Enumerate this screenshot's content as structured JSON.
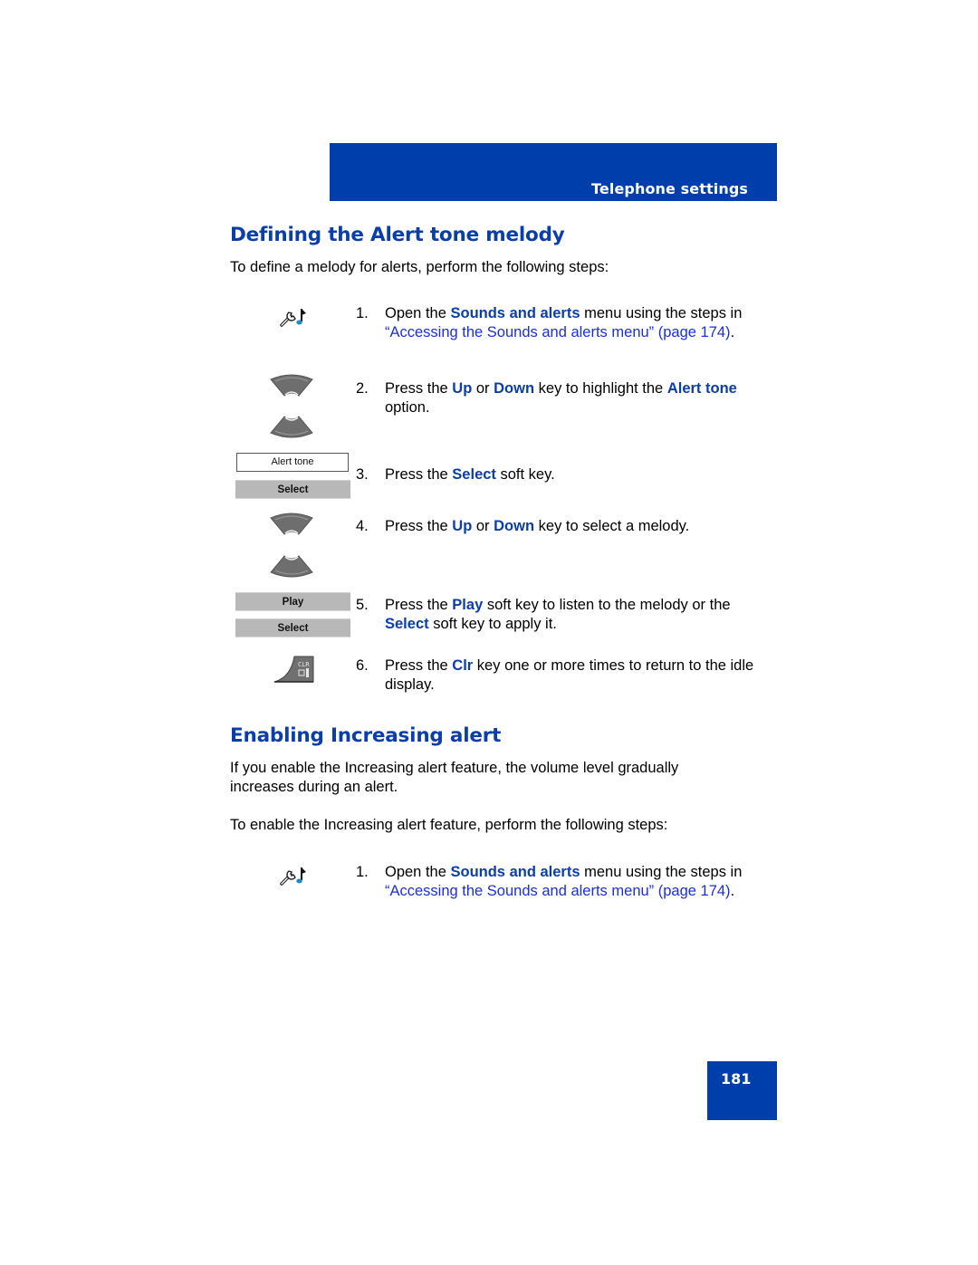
{
  "header": {
    "section_title": "Telephone settings",
    "band_color": "#003fab"
  },
  "section1": {
    "heading": "Defining the Alert tone melody",
    "intro": "To define a melody for alerts, perform the following steps:",
    "display_label": "Alert tone",
    "softkeys": {
      "select_a": "Select",
      "play": "Play",
      "select_b": "Select"
    },
    "clr_key_label": "CLR",
    "steps": [
      {
        "num": "1.",
        "parts": {
          "a": "Open the ",
          "b": "Sounds and alerts",
          "c": " menu using the steps in ",
          "link": "“Accessing the Sounds and alerts menu” (page 174)",
          "d": "."
        }
      },
      {
        "num": "2.",
        "parts": {
          "a": "Press the ",
          "b": "Up",
          "c": " or ",
          "d": "Down",
          "e": " key to highlight the ",
          "f": "Alert tone",
          "g": " option."
        }
      },
      {
        "num": "3.",
        "parts": {
          "a": "Press the ",
          "b": "Select",
          "c": " soft key."
        }
      },
      {
        "num": "4.",
        "parts": {
          "a": "Press the ",
          "b": "Up",
          "c": " or ",
          "d": "Down",
          "e": " key to select a melody."
        }
      },
      {
        "num": "5.",
        "parts": {
          "a": "Press the ",
          "b": "Play",
          "c": " soft key to listen to the melody or the ",
          "d": "Select",
          "e": " soft key to apply it."
        }
      },
      {
        "num": "6.",
        "parts": {
          "a": "Press the ",
          "b": "Clr",
          "c": " key one or more times to return to the idle display."
        }
      }
    ]
  },
  "section2": {
    "heading": "Enabling Increasing alert",
    "para1": "If you enable the Increasing alert feature, the volume level gradually increases during an alert.",
    "para2": "To enable the Increasing alert feature, perform the following steps:",
    "steps": [
      {
        "num": "1.",
        "parts": {
          "a": "Open the ",
          "b": "Sounds and alerts",
          "c": " menu using the steps in ",
          "link": "“Accessing the Sounds and alerts menu” (page 174)",
          "d": "."
        }
      }
    ]
  },
  "footer": {
    "page_number": "181"
  },
  "colors": {
    "keyword": "#0a3ea8",
    "link": "#1a2fe0",
    "softkey_bg": "#b8b8b8"
  }
}
